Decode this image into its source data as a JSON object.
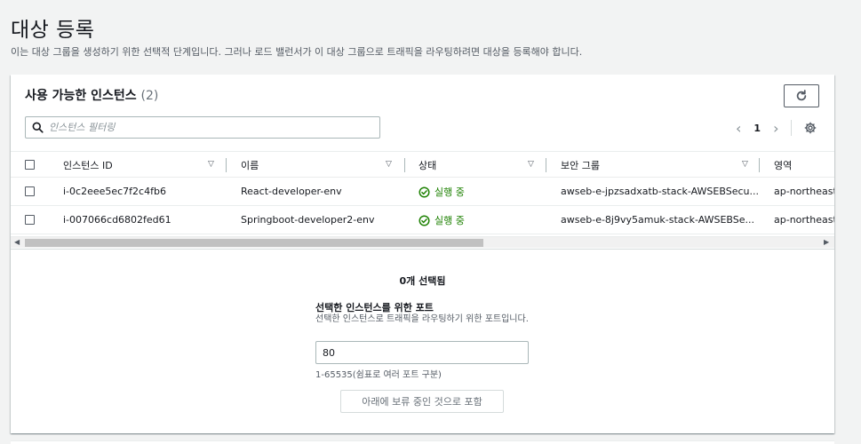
{
  "page": {
    "title": "대상 등록",
    "description": "이는 대상 그룹을 생성하기 위한 선택적 단계입니다. 그러나 로드 밸런서가 이 대상 그룹으로 트래픽을 라우팅하려면 대상을 등록해야 합니다."
  },
  "panel": {
    "title": "사용 가능한 인스턴스",
    "count": "(2)",
    "refresh_icon": "refresh-icon",
    "search": {
      "placeholder": "인스턴스 필터링",
      "value": "",
      "icon": "search-icon"
    },
    "pagination": {
      "current_page": "1",
      "prev_icon": "chevron-left-icon",
      "next_icon": "chevron-right-icon",
      "settings_icon": "gear-icon"
    },
    "table": {
      "columns": [
        "인스턴스 ID",
        "이름",
        "상태",
        "보안 그룹",
        "영역"
      ],
      "rows": [
        {
          "instance_id": "i-0c2eee5ec7f2c4fb6",
          "name": "React-developer-env",
          "state": "실행 중",
          "security_group": "awseb-e-jpzsadxatb-stack-AWSEBSecu...",
          "zone": "ap-northeast"
        },
        {
          "instance_id": "i-007066cd6802fed61",
          "name": "Springboot-developer2-env",
          "state": "실행 중",
          "security_group": "awseb-e-8j9vy5amuk-stack-AWSEBSe...",
          "zone": "ap-northeast"
        }
      ],
      "status_color": "#1d8102"
    }
  },
  "selection": {
    "count_text": "0개 선택됨",
    "port_label": "선택한 인스턴스를 위한 포트",
    "port_description": "선택한 인스턴스로 트래픽을 라우팅하기 위한 포트입니다.",
    "port_value": "80",
    "port_hint": "1-65535(쉼표로 여러 포트 구분)",
    "include_button": "아래에 보류 중인 것으로 포함"
  }
}
